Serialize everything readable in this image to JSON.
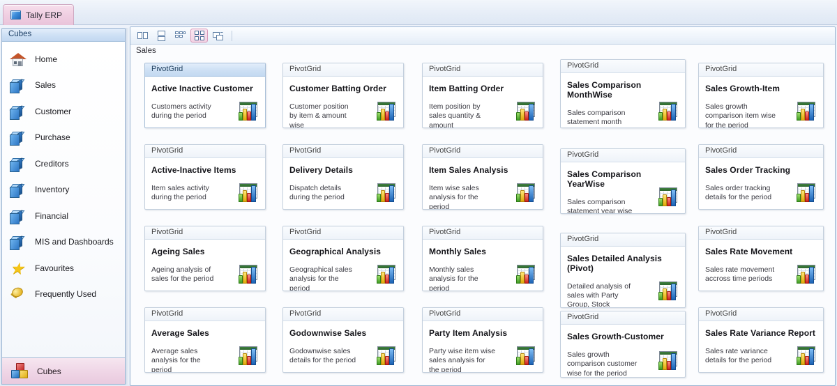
{
  "app": {
    "tab_label": "Tally ERP",
    "tab_icon": "blue-cube-icon"
  },
  "sidebar": {
    "header": "Cubes",
    "items": [
      {
        "label": "Home",
        "icon": "house-icon"
      },
      {
        "label": "Sales",
        "icon": "cube-icon"
      },
      {
        "label": "Customer",
        "icon": "cube-icon"
      },
      {
        "label": "Purchase",
        "icon": "cube-icon"
      },
      {
        "label": "Creditors",
        "icon": "cube-icon"
      },
      {
        "label": "Inventory",
        "icon": "cube-icon"
      },
      {
        "label": "Financial",
        "icon": "cube-icon"
      },
      {
        "label": "MIS and Dashboards",
        "icon": "cube-icon"
      },
      {
        "label": "Favourites",
        "icon": "star-icon"
      },
      {
        "label": "Frequently Used",
        "icon": "pin-icon"
      }
    ],
    "footer": {
      "label": "Cubes",
      "icon": "multi-cube-icon"
    }
  },
  "toolbar": {
    "buttons": [
      {
        "name": "two-column-layout-icon",
        "selected": false
      },
      {
        "name": "two-row-layout-icon",
        "selected": false
      },
      {
        "name": "small-tiles-layout-icon",
        "selected": false
      },
      {
        "name": "large-tiles-layout-icon",
        "selected": true
      },
      {
        "name": "detail-layout-icon",
        "selected": false
      }
    ]
  },
  "main": {
    "group_label": "Sales",
    "card_header": "PivotGrid",
    "card_icon": "pivot-chart-thumbnail-icon",
    "cards": [
      {
        "title": "Active Inactive Customer",
        "desc": "Customers activity during the period",
        "col": 0,
        "row": 0,
        "selected": true
      },
      {
        "title": "Customer Batting Order",
        "desc": "Customer position by item & amount wise",
        "col": 1,
        "row": 0,
        "selected": false
      },
      {
        "title": "Item Batting Order",
        "desc": "Item position by sales quantity & amount",
        "col": 2,
        "row": 0,
        "selected": false
      },
      {
        "title": "Sales Comparison MonthWise",
        "desc": "Sales comparison statement month wise",
        "col": 3,
        "row": 0,
        "selected": false
      },
      {
        "title": "Sales Growth-Item",
        "desc": "Sales growth comparison item wise for the period",
        "col": 4,
        "row": 0,
        "selected": false
      },
      {
        "title": "Active-Inactive Items",
        "desc": "Item sales activity during the period",
        "col": 0,
        "row": 1,
        "selected": false
      },
      {
        "title": "Delivery Details",
        "desc": "Dispatch details during the period",
        "col": 1,
        "row": 1,
        "selected": false
      },
      {
        "title": "Item Sales Analysis",
        "desc": "Item wise sales analysis for the period",
        "col": 2,
        "row": 1,
        "selected": false
      },
      {
        "title": "Sales Comparison YearWise",
        "desc": "Sales comparison statement year wise",
        "col": 3,
        "row": 1,
        "selected": false
      },
      {
        "title": "Sales Order Tracking",
        "desc": "Sales order tracking details for the period",
        "col": 4,
        "row": 1,
        "selected": false
      },
      {
        "title": "Ageing Sales",
        "desc": "Ageing analysis of sales for the period",
        "col": 0,
        "row": 2,
        "selected": false
      },
      {
        "title": "Geographical Analysis",
        "desc": "Geographical sales analysis for the period",
        "col": 1,
        "row": 2,
        "selected": false
      },
      {
        "title": "Monthly Sales",
        "desc": "Monthly sales analysis for the period",
        "col": 2,
        "row": 2,
        "selected": false
      },
      {
        "title": "Sales Detailed Analysis (Pivot)",
        "desc": "Detailed analysis of sales with Party Group, Stock Group,Stock Category, etc.for the Periods",
        "col": 3,
        "row": 2,
        "selected": false
      },
      {
        "title": "Sales Rate Movement",
        "desc": "Sales rate movement accross time periods",
        "col": 4,
        "row": 2,
        "selected": false
      },
      {
        "title": "Average Sales",
        "desc": "Average sales analysis for the period",
        "col": 0,
        "row": 3,
        "selected": false
      },
      {
        "title": "Godownwise Sales",
        "desc": "Godownwise sales details for the period",
        "col": 1,
        "row": 3,
        "selected": false
      },
      {
        "title": "Party Item Analysis",
        "desc": "Party wise item wise sales analysis for the period",
        "col": 2,
        "row": 3,
        "selected": false
      },
      {
        "title": "Sales Growth-Customer",
        "desc": "Sales growth comparison customer wise for the period",
        "col": 3,
        "row": 3,
        "selected": false
      },
      {
        "title": "Sales Rate Variance Report",
        "desc": "Sales rate variance details for the period",
        "col": 4,
        "row": 3,
        "selected": false
      }
    ]
  },
  "colors": {
    "accent_pink": "#f0cfe2",
    "accent_blue": "#cde0f4",
    "pane_border": "#9ab4d2",
    "text": "#15151a"
  }
}
